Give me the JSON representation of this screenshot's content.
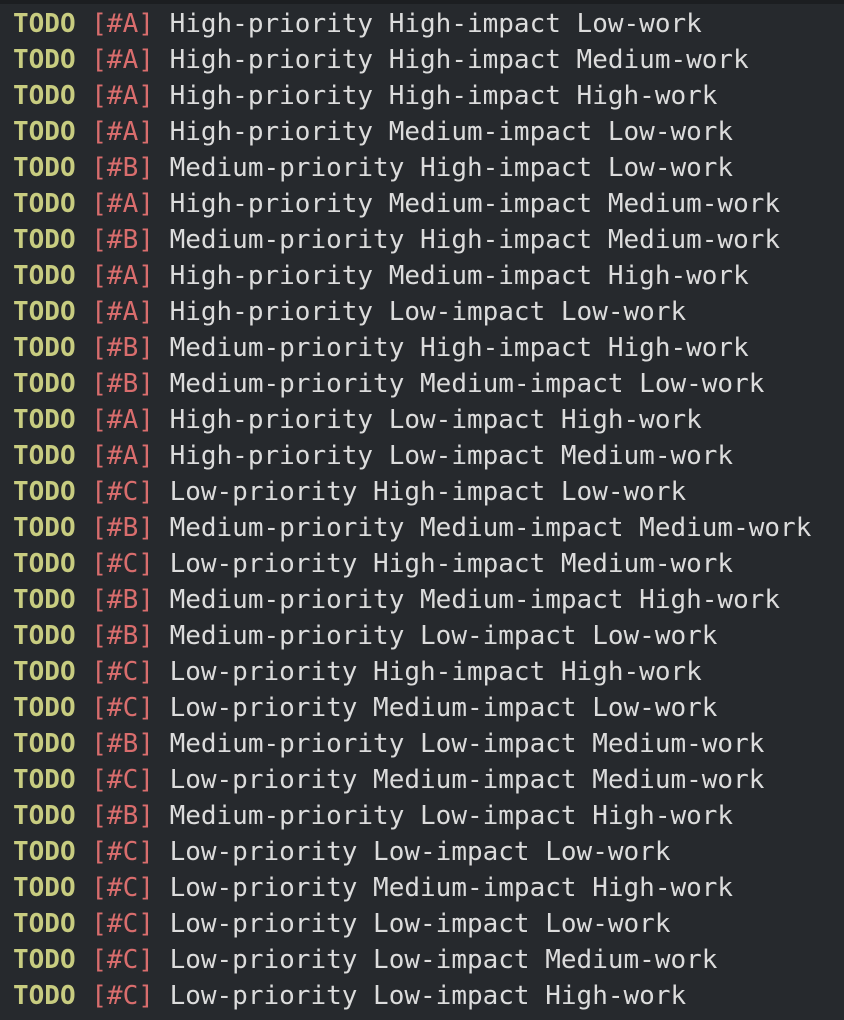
{
  "colors": {
    "background": "#26292d",
    "keyword": "#c8cc80",
    "priority_cookie": "#d96d6d",
    "headline_text": "#dcdcdc"
  },
  "todos": [
    {
      "keyword": "TODO",
      "priority": "[#A]",
      "title": "High-priority High-impact Low-work"
    },
    {
      "keyword": "TODO",
      "priority": "[#A]",
      "title": "High-priority High-impact Medium-work"
    },
    {
      "keyword": "TODO",
      "priority": "[#A]",
      "title": "High-priority High-impact High-work"
    },
    {
      "keyword": "TODO",
      "priority": "[#A]",
      "title": "High-priority Medium-impact Low-work"
    },
    {
      "keyword": "TODO",
      "priority": "[#B]",
      "title": "Medium-priority High-impact Low-work"
    },
    {
      "keyword": "TODO",
      "priority": "[#A]",
      "title": "High-priority Medium-impact Medium-work"
    },
    {
      "keyword": "TODO",
      "priority": "[#B]",
      "title": "Medium-priority High-impact Medium-work"
    },
    {
      "keyword": "TODO",
      "priority": "[#A]",
      "title": "High-priority Medium-impact High-work"
    },
    {
      "keyword": "TODO",
      "priority": "[#A]",
      "title": "High-priority Low-impact Low-work"
    },
    {
      "keyword": "TODO",
      "priority": "[#B]",
      "title": "Medium-priority High-impact High-work"
    },
    {
      "keyword": "TODO",
      "priority": "[#B]",
      "title": "Medium-priority Medium-impact Low-work"
    },
    {
      "keyword": "TODO",
      "priority": "[#A]",
      "title": "High-priority Low-impact High-work"
    },
    {
      "keyword": "TODO",
      "priority": "[#A]",
      "title": "High-priority Low-impact Medium-work"
    },
    {
      "keyword": "TODO",
      "priority": "[#C]",
      "title": "Low-priority High-impact Low-work"
    },
    {
      "keyword": "TODO",
      "priority": "[#B]",
      "title": "Medium-priority Medium-impact Medium-work"
    },
    {
      "keyword": "TODO",
      "priority": "[#C]",
      "title": "Low-priority High-impact Medium-work"
    },
    {
      "keyword": "TODO",
      "priority": "[#B]",
      "title": "Medium-priority Medium-impact High-work"
    },
    {
      "keyword": "TODO",
      "priority": "[#B]",
      "title": "Medium-priority Low-impact Low-work"
    },
    {
      "keyword": "TODO",
      "priority": "[#C]",
      "title": "Low-priority High-impact High-work"
    },
    {
      "keyword": "TODO",
      "priority": "[#C]",
      "title": "Low-priority Medium-impact Low-work"
    },
    {
      "keyword": "TODO",
      "priority": "[#B]",
      "title": "Medium-priority Low-impact Medium-work"
    },
    {
      "keyword": "TODO",
      "priority": "[#C]",
      "title": "Low-priority Medium-impact Medium-work"
    },
    {
      "keyword": "TODO",
      "priority": "[#B]",
      "title": "Medium-priority Low-impact High-work"
    },
    {
      "keyword": "TODO",
      "priority": "[#C]",
      "title": "Low-priority Low-impact Low-work"
    },
    {
      "keyword": "TODO",
      "priority": "[#C]",
      "title": "Low-priority Medium-impact High-work"
    },
    {
      "keyword": "TODO",
      "priority": "[#C]",
      "title": "Low-priority Low-impact Low-work"
    },
    {
      "keyword": "TODO",
      "priority": "[#C]",
      "title": "Low-priority Low-impact Medium-work"
    },
    {
      "keyword": "TODO",
      "priority": "[#C]",
      "title": "Low-priority Low-impact High-work"
    }
  ]
}
